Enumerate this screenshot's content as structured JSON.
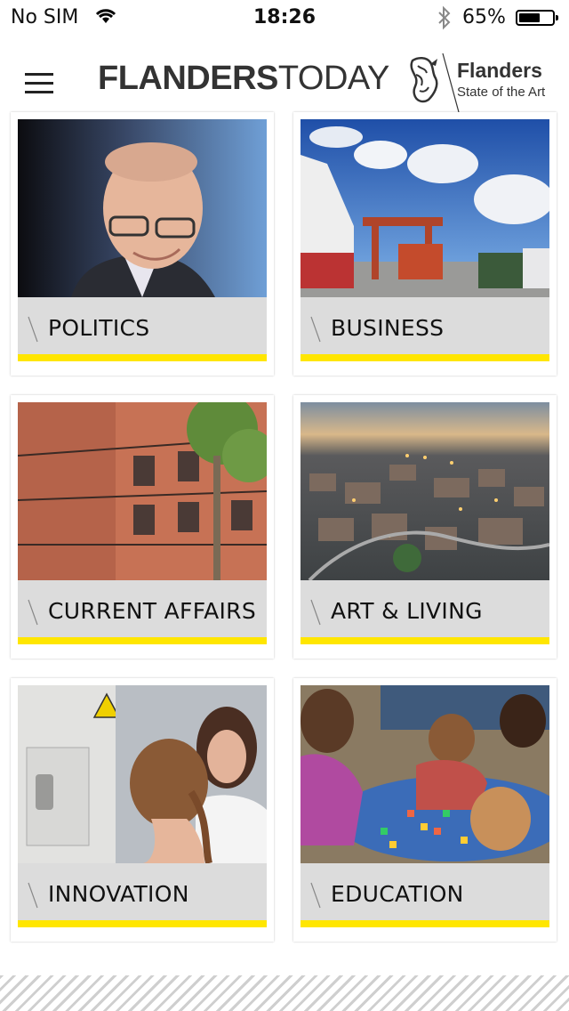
{
  "status_bar": {
    "carrier": "No SIM",
    "time": "18:26",
    "battery": "65%",
    "battery_level": 0.65
  },
  "header": {
    "brand_bold": "FLANDERS",
    "brand_light": "TODAY",
    "partner_name": "Flanders",
    "partner_tagline": "State of the Art",
    "icons": [
      "menu-icon",
      "lion-logo-icon"
    ]
  },
  "sections": [
    {
      "label": "POLITICS",
      "image": "politician-portrait"
    },
    {
      "label": "BUSINESS",
      "image": "harbour-cranes-ship"
    },
    {
      "label": "CURRENT AFFAIRS",
      "image": "brick-apartment-building"
    },
    {
      "label": "ART & LIVING",
      "image": "city-aerial-dusk"
    },
    {
      "label": "INNOVATION",
      "image": "medical-scanner"
    },
    {
      "label": "EDUCATION",
      "image": "children-playing"
    }
  ],
  "colors": {
    "accent": "#ffe600",
    "label_bg": "#dcdcdc",
    "text": "#111111"
  }
}
